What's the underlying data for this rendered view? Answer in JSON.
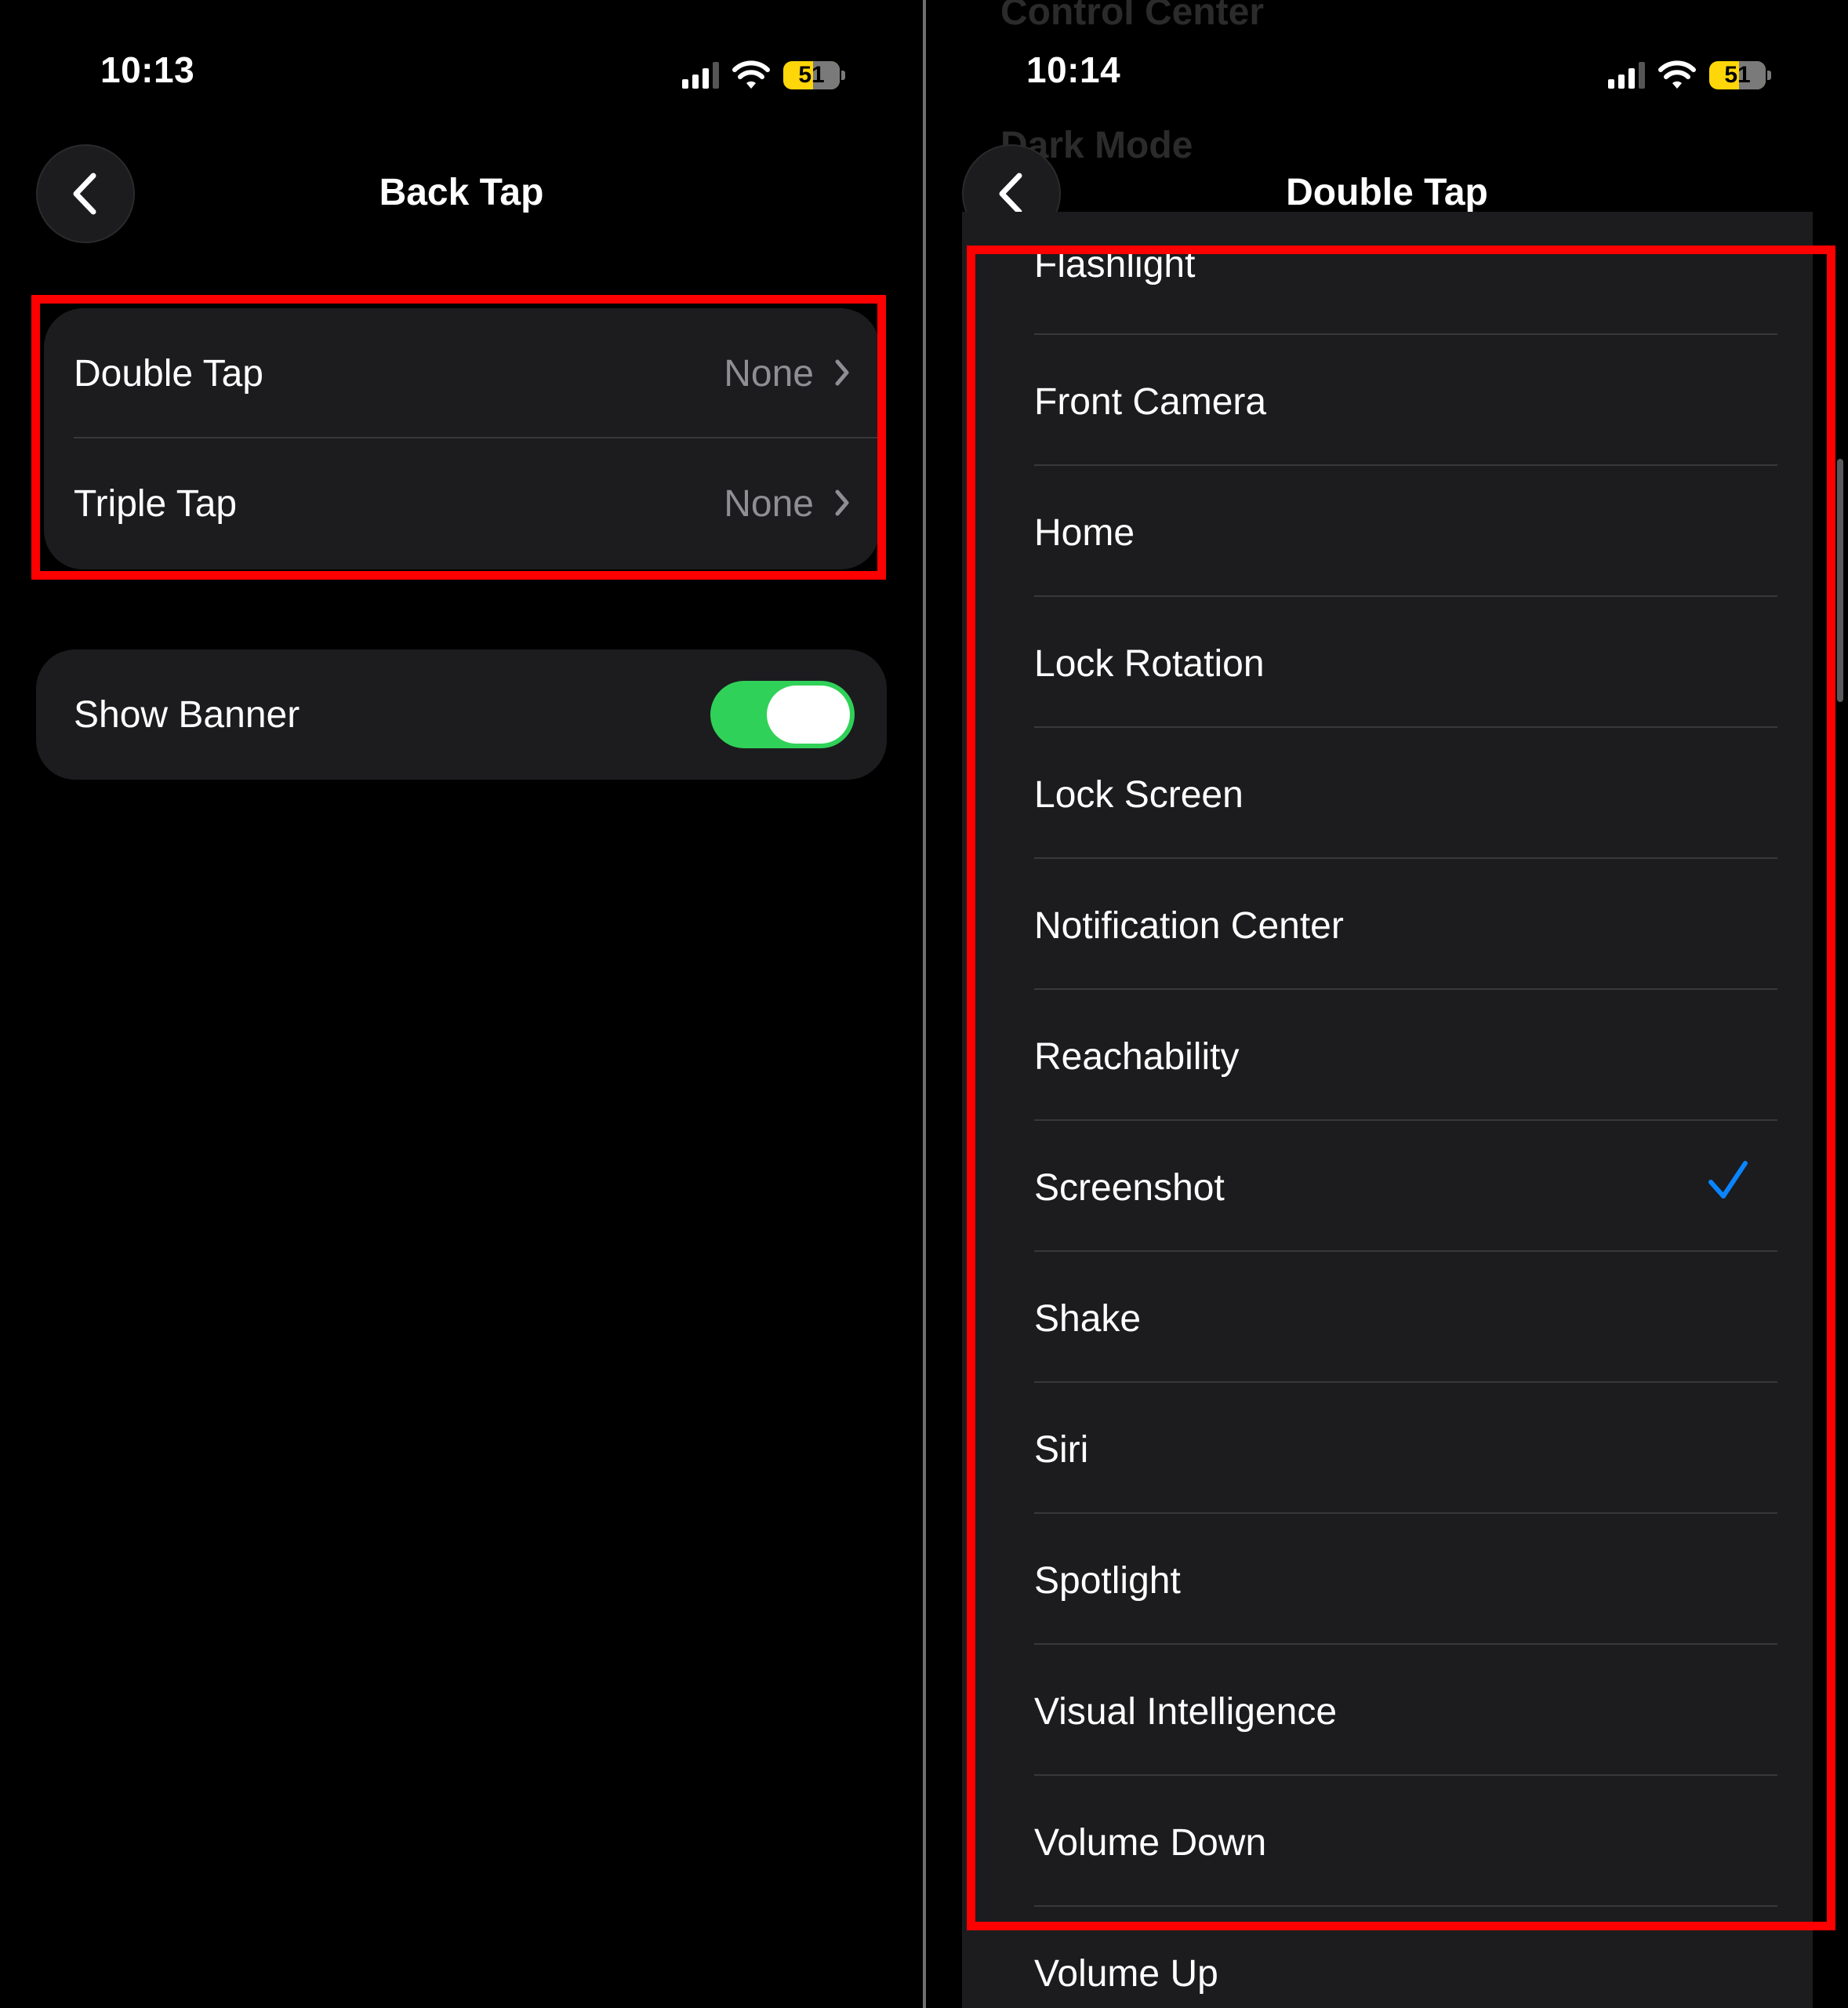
{
  "left": {
    "status": {
      "time": "10:13",
      "battery": "51"
    },
    "nav": {
      "title": "Back Tap"
    },
    "tap_group": [
      {
        "label": "Double Tap",
        "value": "None"
      },
      {
        "label": "Triple Tap",
        "value": "None"
      }
    ],
    "banner": {
      "label": "Show Banner",
      "enabled": true
    }
  },
  "right": {
    "status": {
      "time": "10:14",
      "battery": "51"
    },
    "nav": {
      "title": "Double Tap"
    },
    "ghost_text": [
      "Control Center",
      "Dark Mode"
    ],
    "options": [
      {
        "label": "Flashlight"
      },
      {
        "label": "Front Camera"
      },
      {
        "label": "Home"
      },
      {
        "label": "Lock Rotation"
      },
      {
        "label": "Lock Screen"
      },
      {
        "label": "Notification Center"
      },
      {
        "label": "Reachability"
      },
      {
        "label": "Screenshot",
        "selected": true
      },
      {
        "label": "Shake"
      },
      {
        "label": "Siri"
      },
      {
        "label": "Spotlight"
      },
      {
        "label": "Visual Intelligence"
      },
      {
        "label": "Volume Down"
      },
      {
        "label": "Volume Up"
      }
    ]
  },
  "colors": {
    "highlight": "#ff0000",
    "toggle_on": "#30d158",
    "checkmark": "#0a84ff",
    "battery": "#ffd60a",
    "cell_bg": "#1c1c1e",
    "secondary_text": "#8e8e93"
  },
  "icons": [
    "chevron-left-icon",
    "chevron-right-icon",
    "checkmark-icon",
    "signal-icon",
    "wifi-icon",
    "battery-icon"
  ]
}
